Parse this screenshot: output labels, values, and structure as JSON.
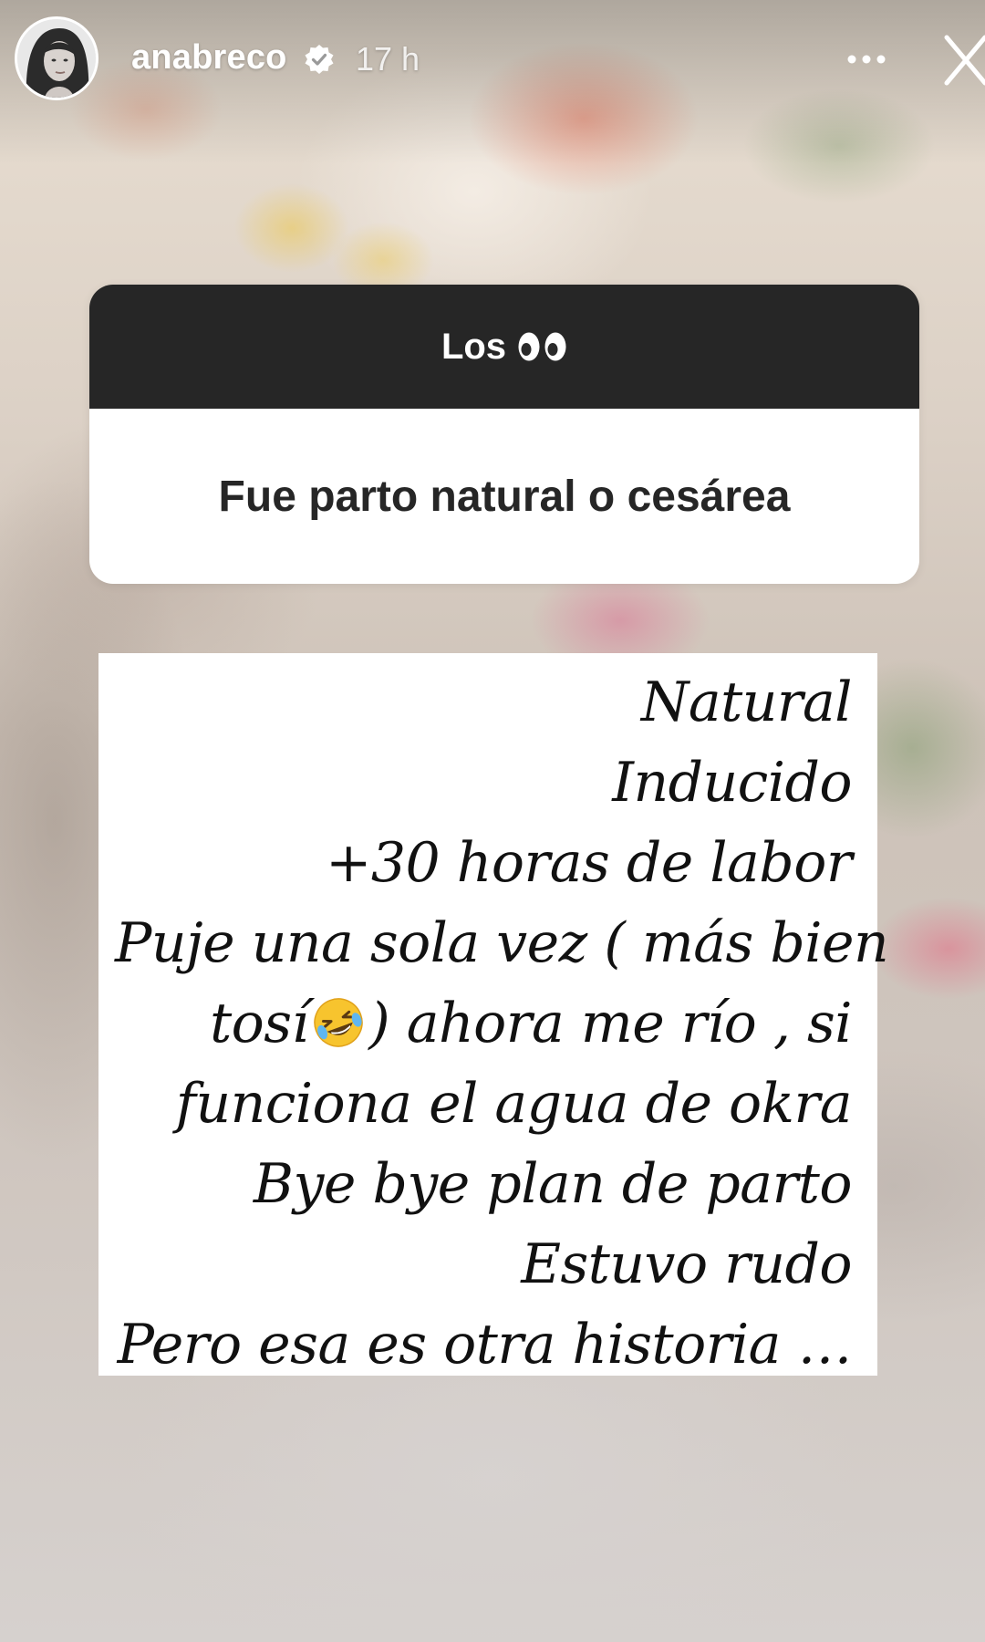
{
  "story": {
    "username": "anabreco",
    "time": "17 h",
    "verified_icon": "verified-badge-icon",
    "more_icon": "more-options-icon",
    "close_icon": "close-icon"
  },
  "question_sticker": {
    "asker": "Los",
    "asker_emoji": "eyes-emoji-icon",
    "question": "Fue parto natural o cesárea"
  },
  "answer": {
    "lines": [
      "Natural",
      "Inducido",
      "+30 horas de labor",
      "Puje una sola vez ( más bien",
      "tosí",
      ") ahora me río , si",
      "funciona el agua de okra",
      "Bye bye plan de parto",
      "Estuvo rudo",
      "Pero esa es otra historia …"
    ],
    "emoji": "rolling-on-floor-laughing-emoji-icon"
  },
  "colors": {
    "sticker_header_bg": "#262626",
    "sticker_body_bg": "#ffffff",
    "answer_bg": "#ffffff",
    "text_dark": "#111111"
  }
}
